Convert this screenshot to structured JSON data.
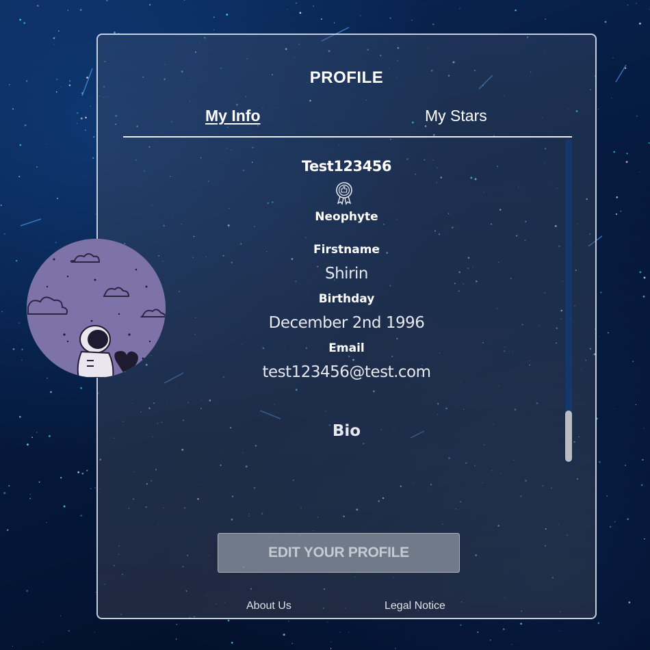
{
  "page": {
    "title": "PROFILE"
  },
  "tabs": [
    {
      "label": "My Info",
      "active": true
    },
    {
      "label": "My Stars",
      "active": false
    }
  ],
  "profile": {
    "username": "Test123456",
    "rank_icon": "badge-icon",
    "rank": "Neophyte",
    "firstname_label": "Firstname",
    "firstname": "Shirin",
    "birthday_label": "Birthday",
    "birthday": "December 2nd 1996",
    "email_label": "Email",
    "email": "test123456@test.com",
    "bio_label": "Bio",
    "avatar_icon": "astronaut-avatar"
  },
  "actions": {
    "edit_label": "EDIT YOUR PROFILE"
  },
  "footer": {
    "about": "About Us",
    "legal": "Legal Notice"
  },
  "colors": {
    "background": "#061c42",
    "scroll_track": "#14386b",
    "scroll_thumb": "#b9bcc3",
    "avatar_bg": "#7d73a8",
    "button_bg": "#8c94a0"
  }
}
